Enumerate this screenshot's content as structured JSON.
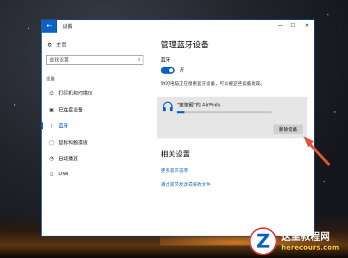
{
  "window": {
    "title": "设置",
    "back_glyph": "←",
    "controls": {
      "minimize": "—",
      "maximize": "☐",
      "close": "✕"
    }
  },
  "sidebar": {
    "home": "主页",
    "search_placeholder": "查找设置",
    "section": "设备",
    "items": [
      {
        "label": "打印机和扫描仪",
        "icon": "printer-icon"
      },
      {
        "label": "已连接设备",
        "icon": "connected-devices-icon"
      },
      {
        "label": "蓝牙",
        "icon": "bluetooth-icon",
        "active": true
      },
      {
        "label": "鼠标和触摸板",
        "icon": "mouse-icon"
      },
      {
        "label": "自动播放",
        "icon": "autoplay-icon"
      },
      {
        "label": "USB",
        "icon": "usb-icon"
      }
    ]
  },
  "main": {
    "title": "管理蓝牙设备",
    "bluetooth_label": "蓝牙",
    "toggle_state": "开",
    "description": "你的电脑正在搜索蓝牙设备，可以被这些设备发现。",
    "device": {
      "name": "\"笙笙瓤\"的 AirPods",
      "remove_label": "删除设备",
      "icon": "headphones-icon"
    },
    "related": {
      "title": "相关设置",
      "links": [
        "更多蓝牙选项",
        "通过蓝牙发送或接收文件"
      ]
    }
  },
  "watermark": {
    "name": "这里教程网",
    "url": "herecours.com",
    "letter": "Z"
  },
  "colors": {
    "accent": "#0b63c6",
    "arrow": "#e2533a"
  }
}
